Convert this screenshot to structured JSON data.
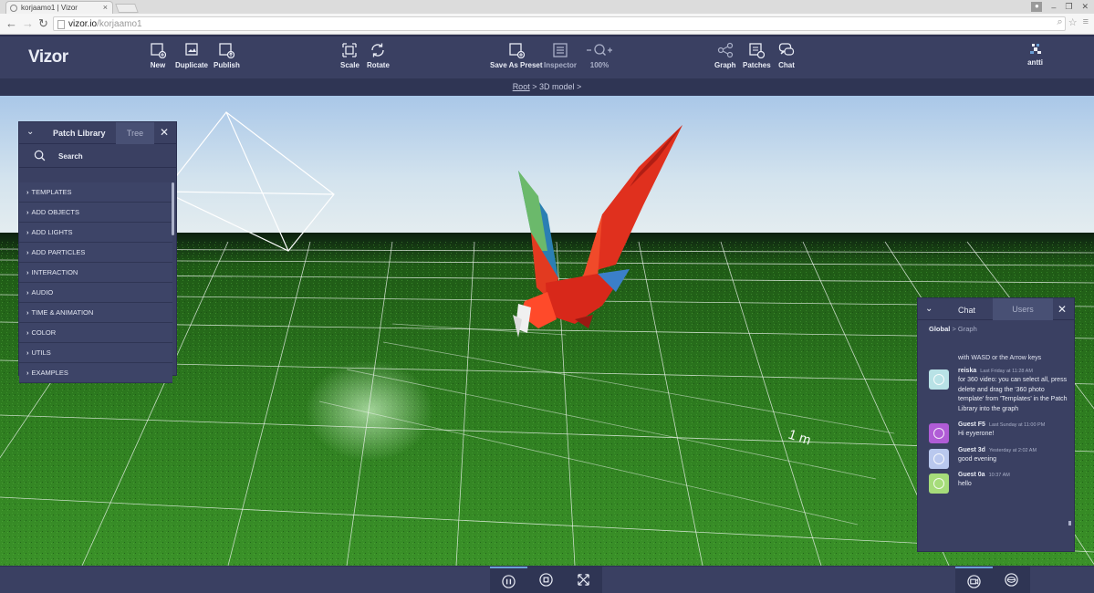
{
  "browser": {
    "tab_title": "korjaamo1 | Vizor",
    "url_host": "vizor.io",
    "url_path": "/korjaamo1",
    "tab_close": "×",
    "win_min": "–",
    "win_max": "❐",
    "win_close": "✕"
  },
  "app": {
    "logo": "Vizor",
    "toolbar": {
      "new": "New",
      "duplicate": "Duplicate",
      "publish": "Publish",
      "scale": "Scale",
      "rotate": "Rotate",
      "save_as_preset": "Save As Preset",
      "inspector": "Inspector",
      "zoom": "100%",
      "graph": "Graph",
      "patches": "Patches",
      "chat": "Chat"
    },
    "user_name": "antti",
    "breadcrumb": {
      "root": "Root",
      "sep": ">",
      "current": "3D model",
      "end": ">"
    }
  },
  "scene": {
    "scale_label": "1 m"
  },
  "patch_library": {
    "title": "Patch Library",
    "tab_tree": "Tree",
    "search_label": "Search",
    "items": [
      "TEMPLATES",
      "ADD OBJECTS",
      "ADD LIGHTS",
      "ADD PARTICLES",
      "INTERACTION",
      "AUDIO",
      "TIME & ANIMATION",
      "COLOR",
      "UTILS",
      "EXAMPLES"
    ]
  },
  "chat": {
    "tab_chat": "Chat",
    "tab_users": "Users",
    "crumb_global": "Global",
    "crumb_sep": ">",
    "crumb_graph": "Graph",
    "cut_line": "with WASD or the Arrow keys",
    "messages": [
      {
        "user": "reiska",
        "time": "Last Friday at 11:28 AM",
        "text": "for 360 video: you can select all, press delete and drag the '360 photo template' from 'Templates' in the Patch Library into the graph",
        "color": "#b8e2e6"
      },
      {
        "user": "Guest F5",
        "time": "Last Sunday at 11:00 PM",
        "text": "Hi eyyerone!",
        "color": "#b05cd6"
      },
      {
        "user": "Guest 3d",
        "time": "Yesterday at 2:02 AM",
        "text": "good evening",
        "color": "#b9c8ee"
      },
      {
        "user": "Guest 0a",
        "time": "10:37 AM",
        "text": "hello",
        "color": "#a6dc7a"
      }
    ]
  },
  "colors": {
    "toolbar_bg": "#3a4062",
    "panel_bg": "#3a4062",
    "accent": "#6a9fd6",
    "sky_top": "#a9c9ea",
    "grass": "#2f7d1e",
    "bird_red": "#e0301e"
  }
}
